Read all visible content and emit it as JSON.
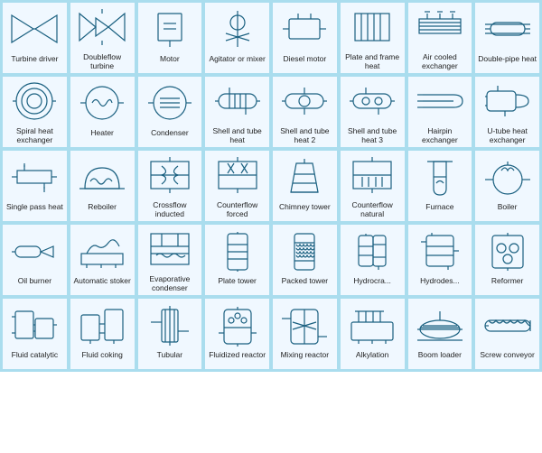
{
  "items": [
    {
      "label": "Turbine driver"
    },
    {
      "label": "Doubleflow turbine"
    },
    {
      "label": "Motor"
    },
    {
      "label": "Agitator or mixer"
    },
    {
      "label": "Diesel motor"
    },
    {
      "label": "Plate and frame heat"
    },
    {
      "label": "Air cooled exchanger"
    },
    {
      "label": "Double-pipe heat"
    },
    {
      "label": "Spiral heat exchanger"
    },
    {
      "label": "Heater"
    },
    {
      "label": "Condenser"
    },
    {
      "label": "Shell and tube heat"
    },
    {
      "label": "Shell and tube heat 2"
    },
    {
      "label": "Shell and tube heat 3"
    },
    {
      "label": "Hairpin exchanger"
    },
    {
      "label": "U-tube heat exchanger"
    },
    {
      "label": "Single pass heat"
    },
    {
      "label": "Reboiler"
    },
    {
      "label": "Crossflow inducted"
    },
    {
      "label": "Counterflow forced"
    },
    {
      "label": "Chimney tower"
    },
    {
      "label": "Counterflow natural"
    },
    {
      "label": "Furnace"
    },
    {
      "label": "Boiler"
    },
    {
      "label": "Oil burner"
    },
    {
      "label": "Automatic stoker"
    },
    {
      "label": "Evaporative condenser"
    },
    {
      "label": "Plate tower"
    },
    {
      "label": "Packed tower"
    },
    {
      "label": "Hydrocra..."
    },
    {
      "label": "Hydrodes..."
    },
    {
      "label": "Reformer"
    },
    {
      "label": "Fluid catalytic"
    },
    {
      "label": "Fluid coking"
    },
    {
      "label": "Tubular"
    },
    {
      "label": "Fluidized reactor"
    },
    {
      "label": "Mixing reactor"
    },
    {
      "label": "Alkylation"
    },
    {
      "label": "Boom loader"
    },
    {
      "label": "Screw conveyor"
    }
  ]
}
